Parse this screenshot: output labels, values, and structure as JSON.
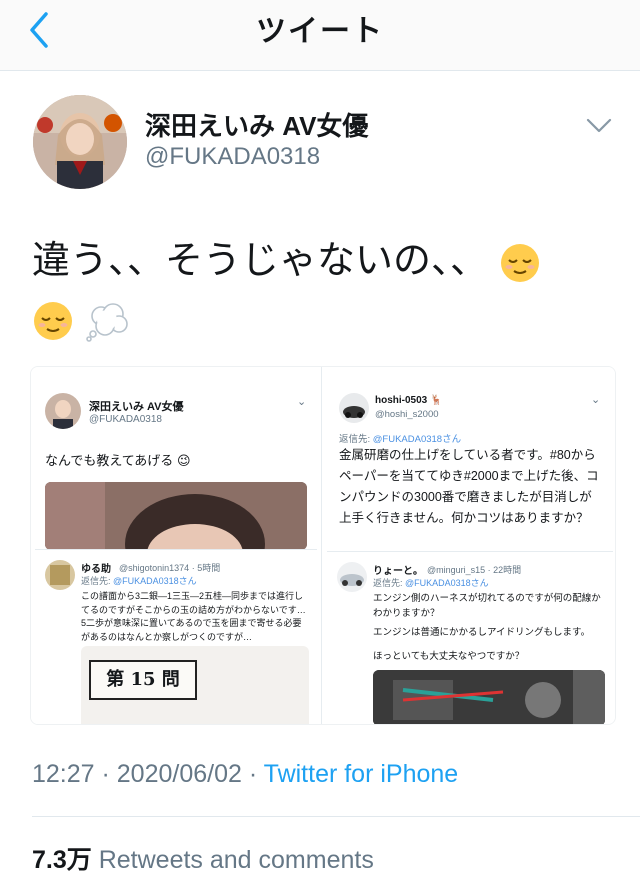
{
  "header": {
    "title": "ツイート",
    "back_icon": "chevron-left-icon"
  },
  "tweet": {
    "author_name": "深田えいみ AV女優",
    "author_handle": "@FUKADA0318",
    "text": "違う、、そうじゃないの、、",
    "emojis": [
      "relieved-face-icon",
      "relieved-face-icon",
      "thought-balloon-icon"
    ],
    "timestamp": "12:27 · 2020/06/02 · ",
    "source": "Twitter for iPhone",
    "retweet_count": "7.3万",
    "retweet_label": "Retweets and comments"
  },
  "media": {
    "left": {
      "name": "深田えいみ AV女優",
      "handle": "@FUKADA0318",
      "text": "なんでも教えてあげる",
      "reply_name": "ゆる助",
      "reply_handle": "@shigotonin1374 · 5時間",
      "reply_to_prefix": "返信先: ",
      "reply_to_handle": "@FUKADA0318さん",
      "reply_text": "この譜面から3二銀—1三玉—2五桂—同歩までは進行してるのですがそこからの玉の詰め方がわからないです…5二歩が意味深に置いてあるので玉を囲まで寄せる必要があるのはなんとか察しがつくのですが…",
      "paper_text": "第 15 問"
    },
    "right": {
      "name": "hoshi-0503",
      "handle": "@hoshi_s2000",
      "reply_to_prefix": "返信先: ",
      "reply_to_handle": "@FUKADA0318さん",
      "text": "金属研磨の仕上げをしている者です。#80からペーパーを当ててゆき#2000まで上げた後、コンパウンドの3000番で磨きましたが目消しが上手く行きません。何かコツはありますか？",
      "reply_name": "りょーと。",
      "reply_handle": "@minguri_s15 · 22時間",
      "reply2_to_prefix": "返信先: ",
      "reply2_to_handle": "@FUKADA0318さん",
      "reply_text1": "エンジン側のハーネスが切れてるのですが何の配線かわかりますか？",
      "reply_text2": "エンジンは普通にかかるしアイドリングもします。",
      "reply_text3": "ほっといても大丈夫なやつですか？"
    }
  },
  "colors": {
    "link": "#1da1f2",
    "muted": "#657786",
    "text": "#14171a"
  }
}
